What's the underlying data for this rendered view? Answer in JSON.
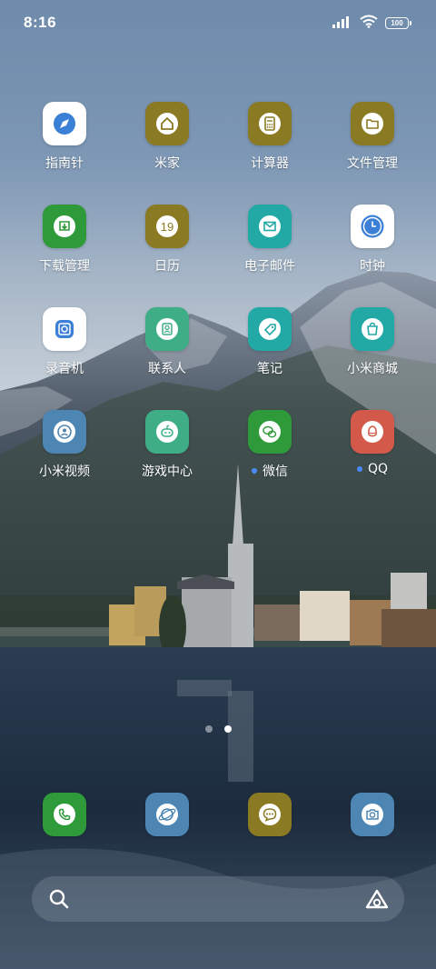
{
  "status_bar": {
    "time": "8:16",
    "battery": "100"
  },
  "apps": [
    {
      "label": "指南针",
      "icon": "compass-icon",
      "bg": "#ffffff",
      "fg": "#3b7fd6"
    },
    {
      "label": "米家",
      "icon": "home-icon",
      "bg": "#8b7a24",
      "fg": "#ffffff"
    },
    {
      "label": "计算器",
      "icon": "calculator-icon",
      "bg": "#8b7a24",
      "fg": "#ffffff"
    },
    {
      "label": "文件管理",
      "icon": "folder-icon",
      "bg": "#8b7a24",
      "fg": "#ffffff"
    },
    {
      "label": "下载管理",
      "icon": "download-icon",
      "bg": "#2f9a3a",
      "fg": "#ffffff"
    },
    {
      "label": "日历",
      "icon": "calendar-icon",
      "bg": "#8b7a24",
      "fg": "#ffffff",
      "text": "19"
    },
    {
      "label": "电子邮件",
      "icon": "mail-icon",
      "bg": "#22a9a6",
      "fg": "#ffffff"
    },
    {
      "label": "时钟",
      "icon": "clock-icon",
      "bg": "#ffffff",
      "fg": "#3b7fd6"
    },
    {
      "label": "录音机",
      "icon": "recorder-icon",
      "bg": "#ffffff",
      "fg": "#3b7fd6"
    },
    {
      "label": "联系人",
      "icon": "contacts-icon",
      "bg": "#3fae86",
      "fg": "#ffffff"
    },
    {
      "label": "笔记",
      "icon": "notes-tag-icon",
      "bg": "#22a9a6",
      "fg": "#ffffff"
    },
    {
      "label": "小米商城",
      "icon": "shopping-bag-icon",
      "bg": "#22a9a6",
      "fg": "#ffffff"
    },
    {
      "label": "小米视频",
      "icon": "video-icon",
      "bg": "#4d86b3",
      "fg": "#ffffff"
    },
    {
      "label": "游戏中心",
      "icon": "gamepad-icon",
      "bg": "#3fae86",
      "fg": "#ffffff"
    },
    {
      "label": "微信",
      "icon": "wechat-icon",
      "bg": "#2f9a3a",
      "fg": "#ffffff",
      "dot": true
    },
    {
      "label": "QQ",
      "icon": "qq-icon",
      "bg": "#d35a4b",
      "fg": "#ffffff",
      "dot": true
    }
  ],
  "dock": [
    {
      "icon": "phone-icon",
      "bg": "#2f9a3a"
    },
    {
      "icon": "browser-icon",
      "bg": "#4d86b3"
    },
    {
      "icon": "messages-icon",
      "bg": "#8b7a24"
    },
    {
      "icon": "camera-icon",
      "bg": "#4d86b3"
    }
  ],
  "page_indicator": {
    "pages": 2,
    "active": 2
  }
}
